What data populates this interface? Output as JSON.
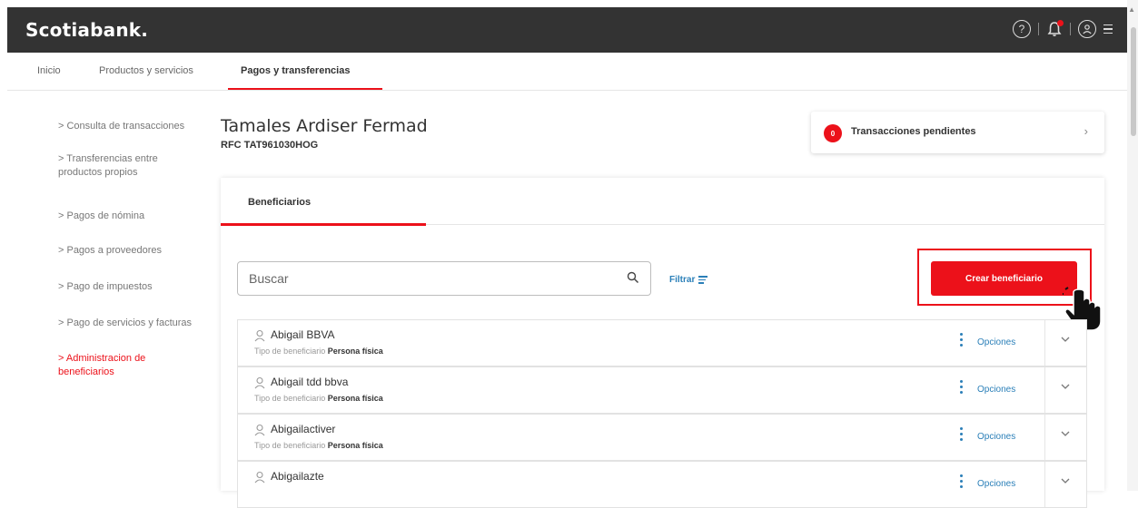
{
  "header": {
    "logo": "Scotiabank.",
    "icons": [
      "help-icon",
      "notifications-icon",
      "profile-icon",
      "menu-icon"
    ],
    "brand_color": "#ec111a"
  },
  "nav": {
    "items": [
      {
        "label": "Inicio"
      },
      {
        "label": "Productos y servicios"
      },
      {
        "label": "Pagos y transferencias",
        "active": true
      }
    ]
  },
  "sidebar": {
    "items": [
      {
        "label": "> Consulta de transacciones"
      },
      {
        "label": "> Transferencias entre productos propios"
      },
      {
        "label": "> Pagos de nómina"
      },
      {
        "label": "> Pagos a proveedores"
      },
      {
        "label": "> Pago de impuestos"
      },
      {
        "label": "> Pago de servicios y facturas"
      },
      {
        "label": "> Administracion de beneficiarios",
        "active": true
      }
    ]
  },
  "client": {
    "name": "Tamales Ardiser Fermad",
    "rfc": "RFC TAT961030HOG"
  },
  "pending": {
    "count": "0",
    "label": "Transacciones pendientes"
  },
  "tabs": {
    "active": "Beneficiarios"
  },
  "search": {
    "placeholder": "Buscar"
  },
  "filter": {
    "label": "Filtrar"
  },
  "create_button": {
    "label": "Crear beneficiario"
  },
  "beneficiaries": [
    {
      "name": "Abigail BBVA",
      "type_label": "Tipo de beneficiario",
      "type_value": "Persona física",
      "options": "Opciones"
    },
    {
      "name": "Abigail tdd bbva",
      "type_label": "Tipo de beneficiario",
      "type_value": "Persona física",
      "options": "Opciones"
    },
    {
      "name": "Abigailactiver",
      "type_label": "Tipo de beneficiario",
      "type_value": "Persona física",
      "options": "Opciones"
    },
    {
      "name": "Abigailazte",
      "type_label": "",
      "type_value": "",
      "options": "Opciones"
    }
  ]
}
